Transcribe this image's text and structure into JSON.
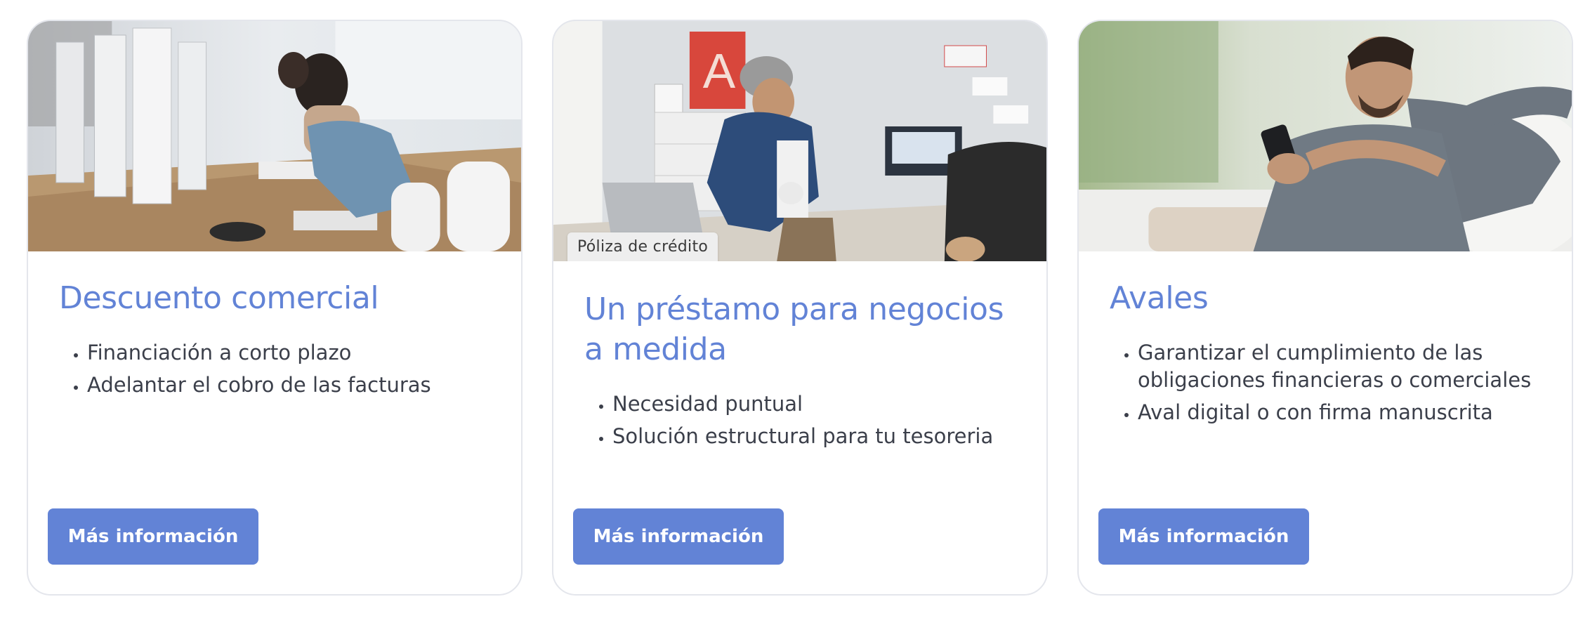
{
  "cards": [
    {
      "title": "Descuento comercial",
      "points": [
        "Financiación a corto plazo",
        "Adelantar el cobro de las facturas"
      ],
      "button_label": "Más información",
      "image": "office-workers-at-computers"
    },
    {
      "tag": "Póliza de crédito",
      "title": "Un préstamo para negocios a medida",
      "points": [
        "Necesidad puntual",
        "Solución estructural para tu tesoreria"
      ],
      "button_label": "Más información",
      "image": "man-leaning-over-laptop-in-studio"
    },
    {
      "title": "Avales",
      "points": [
        "Garantizar el cumplimiento de las obligaciones financieras o comerciales",
        "Aval digital o con firma manuscrita"
      ],
      "button_label": "Más información",
      "image": "man-using-smartphone-on-sofa"
    }
  ],
  "colors": {
    "accent": "#6283d6",
    "text": "#3b3f4a",
    "border": "#e4e6ec",
    "tag_bg": "#eeeeee"
  }
}
